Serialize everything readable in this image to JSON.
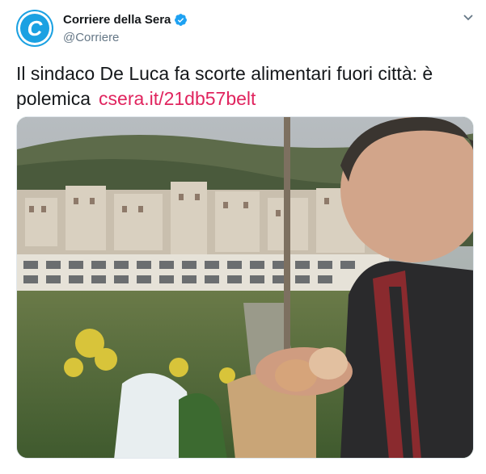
{
  "author": {
    "name": "Corriere della Sera",
    "handle": "@Corriere",
    "avatar_icon": "corriere-c-logo",
    "verified_icon": "verified-badge-icon",
    "brand_color": "#1ba1e2"
  },
  "tweet": {
    "text": "Il sindaco De Luca fa scorte alimentari fuori città: è polemica",
    "link": "csera.it/21db57belt",
    "link_color": "#e0245e"
  },
  "media": {
    "image_icon": "photo-man-holding-eggs"
  },
  "menu": {
    "icon": "chevron-down-icon"
  }
}
